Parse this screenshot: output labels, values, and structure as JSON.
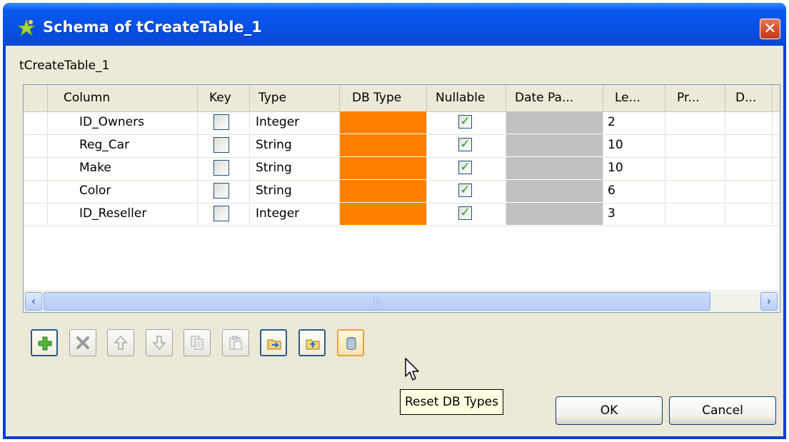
{
  "window": {
    "title": "Schema of tCreateTable_1",
    "close_label": "✕"
  },
  "section_label": "tCreateTable_1",
  "table": {
    "columns": [
      "Column",
      "Key",
      "Type",
      "DB Type",
      "Nullable",
      "Date Pa...",
      "Le...",
      "Pr...",
      "D..."
    ],
    "rows": [
      {
        "column": "ID_Owners",
        "key": false,
        "type": "Integer",
        "nullable": true,
        "length": "2"
      },
      {
        "column": "Reg_Car",
        "key": false,
        "type": "String",
        "nullable": true,
        "length": "10"
      },
      {
        "column": "Make",
        "key": false,
        "type": "String",
        "nullable": true,
        "length": "10"
      },
      {
        "column": "Color",
        "key": false,
        "type": "String",
        "nullable": true,
        "length": "6"
      },
      {
        "column": "ID_Reseller",
        "key": false,
        "type": "Integer",
        "nullable": true,
        "length": "3"
      }
    ],
    "db_type_color": "#ff8000",
    "date_pattern_color": "#c0c0c0"
  },
  "toolbar": {
    "buttons": [
      "add-icon",
      "delete-icon",
      "move-up-icon",
      "move-down-icon",
      "copy-icon",
      "paste-icon",
      "import-icon",
      "export-icon",
      "reset-db-types-icon"
    ]
  },
  "tooltip": "Reset DB Types",
  "buttons": {
    "ok_label": "OK",
    "cancel_label": "Cancel"
  }
}
